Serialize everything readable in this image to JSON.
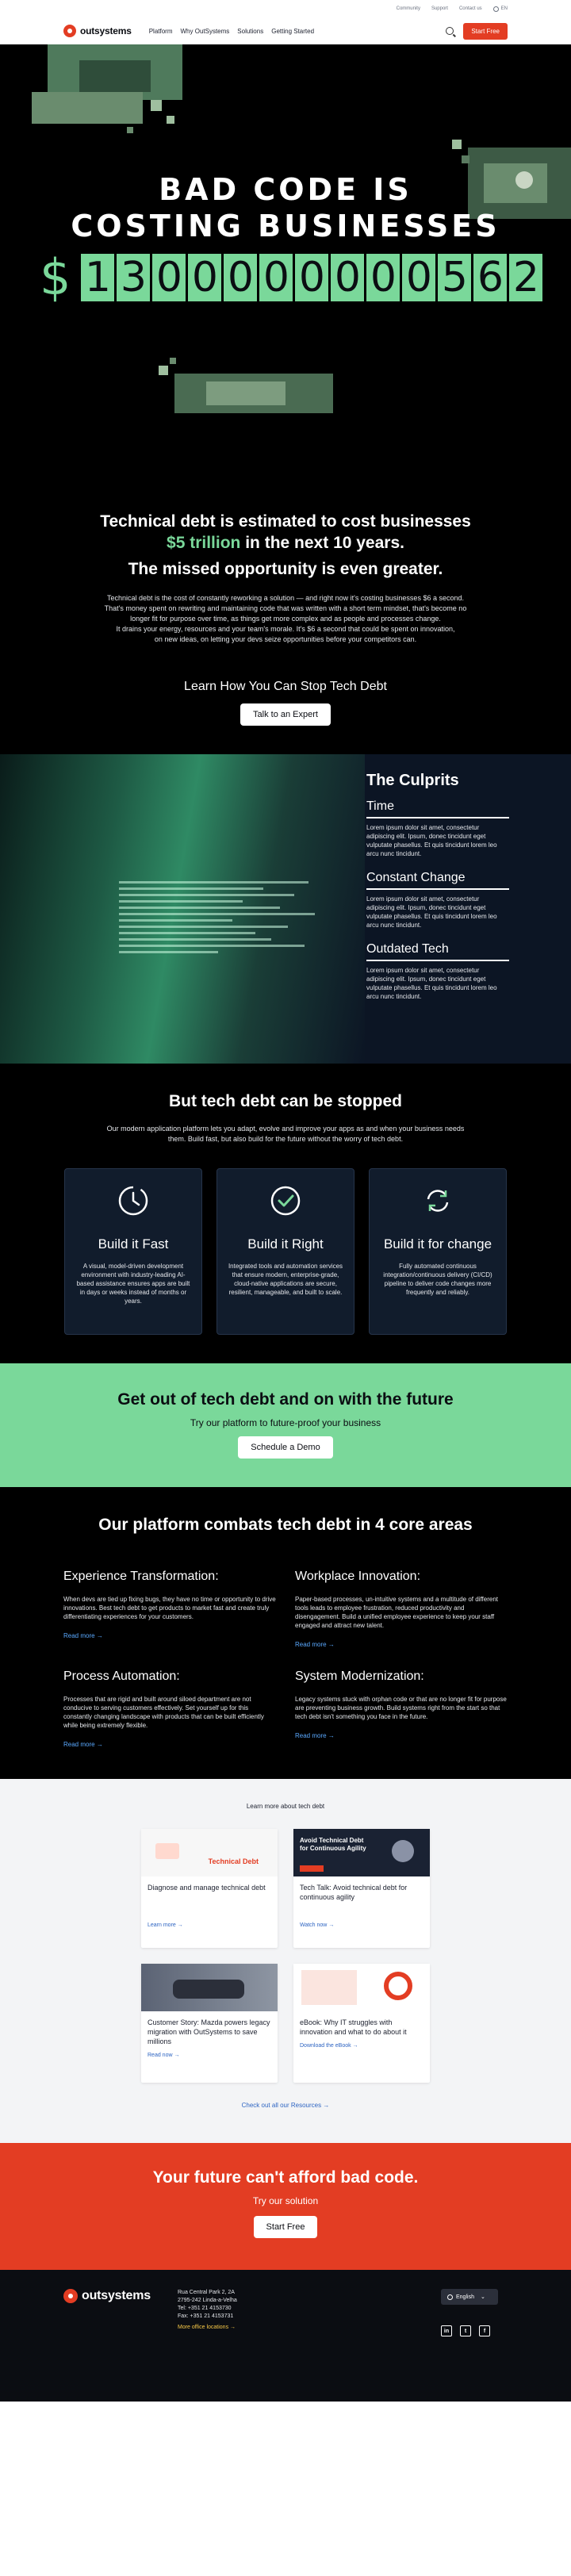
{
  "utility_nav": {
    "links": [
      "Community",
      "Support",
      "Contact us"
    ],
    "language": "EN"
  },
  "nav": {
    "logo": "outsystems",
    "links": [
      "Platform",
      "Why OutSystems",
      "Solutions",
      "Getting Started"
    ],
    "start_free": "Start Free"
  },
  "hero": {
    "title_line1": "BAD CODE IS",
    "title_line2": "COSTING BUSINESSES",
    "currency": "$",
    "counter_digits": [
      "1",
      "3",
      "0",
      "0",
      "0",
      "0",
      "0",
      "0",
      "0",
      "0",
      "5",
      "6",
      "2"
    ]
  },
  "intro": {
    "headline_part1": "Technical debt is estimated to cost businesses",
    "headline_highlight": "$5 trillion",
    "headline_part2": "in the next 10 years.",
    "subheadline": "The missed opportunity is even greater.",
    "body_line1": "Technical debt is the cost of constantly reworking a solution — and right now it's costing businesses $6 a second.",
    "body_line2": "That's money spent on rewriting and maintaining code that was written with a short term mindset, that's become no",
    "body_line3": "longer fit for purpose over time, as things get more complex and as people and processes change.",
    "body_line4": "It drains your energy, resources and your team's morale. It's $6 a second that could be spent on innovation,",
    "body_line5": "on new ideas, on letting your devs seize opportunities before your competitors can.",
    "learn_heading": "Learn How You Can Stop Tech Debt",
    "expert_button": "Talk to an Expert"
  },
  "culprits": {
    "heading": "The Culprits",
    "items": [
      {
        "title": "Time",
        "text": "Lorem ipsum dolor sit amet, consectetur adipiscing elit. Ipsum, donec tincidunt eget vulputate phasellus. Et quis tincidunt lorem leo arcu nunc tincidunt."
      },
      {
        "title": "Constant Change",
        "text": "Lorem ipsum dolor sit amet, consectetur adipiscing elit. Ipsum, donec tincidunt eget vulputate phasellus. Et quis tincidunt lorem leo arcu nunc tincidunt."
      },
      {
        "title": "Outdated Tech",
        "text": "Lorem ipsum dolor sit amet, consectetur adipiscing elit. Ipsum, donec tincidunt eget vulputate phasellus. Et quis tincidunt lorem leo arcu nunc tincidunt."
      }
    ]
  },
  "stopped": {
    "heading": "But tech debt can be stopped",
    "sub_line1": "Our modern application platform lets you adapt, evolve and improve your apps as and when your business needs",
    "sub_line2": "them. Build fast, but also build for the future without the worry of tech debt.",
    "cards": [
      {
        "icon": "clock-icon",
        "title": "Build it Fast",
        "text": "A visual, model-driven development environment with industry-leading AI-based assistance ensures apps are built in days or weeks instead of months or years."
      },
      {
        "icon": "check-circle-icon",
        "title": "Build it Right",
        "text": "Integrated tools and automation services that ensure modern, enterprise-grade, cloud-native applications are secure, resilient, manageable, and built to scale."
      },
      {
        "icon": "refresh-icon",
        "title": "Build it for change",
        "text": "Fully automated continuous integration/continuous delivery (CI/CD) pipeline to deliver code changes more frequently and reliably."
      }
    ]
  },
  "green_cta": {
    "heading": "Get out of tech debt and on with the future",
    "sub": "Try our platform to future-proof your business",
    "button": "Schedule a Demo"
  },
  "areas": {
    "heading": "Our platform combats tech debt in 4 core areas",
    "items": [
      {
        "title": "Experience Transformation:",
        "text": "When devs are tied up fixing bugs, they have no time or opportunity to drive innovations. Best tech debt to get products to market fast and create truly differentiating experiences for your customers.",
        "link": "Read more"
      },
      {
        "title": "Workplace Innovation:",
        "text": "Paper-based processes, un-intuitive systems and a multitude of different tools leads to employee frustration, reduced productivity and disengagement. Build a unified employee experience to keep your staff engaged and attract new talent.",
        "link": "Read more"
      },
      {
        "title": "Process Automation:",
        "text": "Processes that are rigid and built around siloed department are not conducive to serving customers effectively. Set yourself up for this constantly changing landscape with products that can be built efficiently while being extremely flexible.",
        "link": "Read more"
      },
      {
        "title": "System Modernization:",
        "text": "Legacy systems stuck with orphan code or that are no longer fit for purpose are preventing business growth. Build systems right from the start so that tech debt isn't something you face in the future.",
        "link": "Read more"
      }
    ]
  },
  "resources": {
    "label": "Learn more about tech debt",
    "cards": [
      {
        "title": "Diagnose and manage technical debt",
        "cta": "Learn more",
        "thumb_label": "Technical Debt"
      },
      {
        "title": "Tech Talk: Avoid technical debt for continuous agility",
        "cta": "Watch now",
        "thumb_label": "Avoid Technical Debt for Continuous Agility"
      },
      {
        "title": "Customer Story: Mazda powers legacy migration with OutSystems to save millions",
        "cta": "Read now",
        "thumb_label": ""
      },
      {
        "title": "eBook: Why IT struggles with innovation and what to do about it",
        "cta": "Download the eBook",
        "thumb_label": ""
      }
    ],
    "check_all": "Check out all our Resources"
  },
  "red_cta": {
    "heading": "Your future can't afford bad code.",
    "sub": "Try our solution",
    "button": "Start Free"
  },
  "footer": {
    "logo": "outsystems",
    "address_line1": "Rua Central Park 2, 2A",
    "address_line2": "2795-242 Linda-a-Velha",
    "phone": "Tel: +351 21 4153730",
    "fax": "Fax: +351 21 4153731",
    "more_offices": "More office locations",
    "language": "English",
    "social": [
      "in",
      "t",
      "f"
    ]
  },
  "colors": {
    "brand_red": "#e33d23",
    "accent_green": "#7ad89a",
    "dark": "#000000",
    "link_blue": "#5aa9ff"
  }
}
